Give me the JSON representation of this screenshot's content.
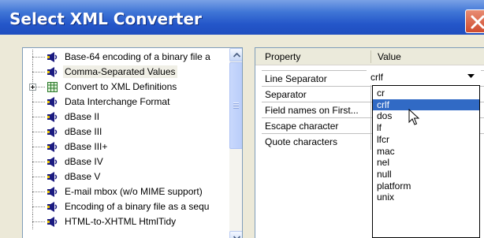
{
  "window": {
    "title": "Select XML Converter"
  },
  "converter_list": {
    "selected_index": 1,
    "items": [
      {
        "label": "Base-64 encoding of a binary file a",
        "icon": "speaker-icon"
      },
      {
        "label": "Comma-Separated Values",
        "icon": "speaker-icon"
      },
      {
        "label": "Convert to XML Definitions",
        "icon": "table-icon",
        "expandable": true
      },
      {
        "label": "Data Interchange Format",
        "icon": "speaker-icon"
      },
      {
        "label": "dBase II",
        "icon": "speaker-icon"
      },
      {
        "label": "dBase III",
        "icon": "speaker-icon"
      },
      {
        "label": "dBase III+",
        "icon": "speaker-icon"
      },
      {
        "label": "dBase IV",
        "icon": "speaker-icon"
      },
      {
        "label": "dBase V",
        "icon": "speaker-icon"
      },
      {
        "label": "E-mail mbox (w/o MIME support)",
        "icon": "speaker-icon"
      },
      {
        "label": "Encoding of a binary file as a sequ",
        "icon": "speaker-icon"
      },
      {
        "label": "HTML-to-XHTML HtmlTidy",
        "icon": "speaker-icon"
      }
    ]
  },
  "property_grid": {
    "header_property": "Property",
    "header_value": "Value",
    "rows": [
      {
        "name": "Line Separator"
      },
      {
        "name": "Separator"
      },
      {
        "name": "Field names on First..."
      },
      {
        "name": "Escape character"
      },
      {
        "name": "Quote characters"
      }
    ],
    "active_value": "crlf"
  },
  "dropdown": {
    "highlighted_index": 1,
    "options": [
      "cr",
      "crlf",
      "dos",
      "lf",
      "lfcr",
      "mac",
      "nel",
      "null",
      "platform",
      "unix"
    ]
  },
  "colors": {
    "title_bar": "#2456c9",
    "selection": "#316ac5",
    "window_bg": "#ece9d8"
  }
}
